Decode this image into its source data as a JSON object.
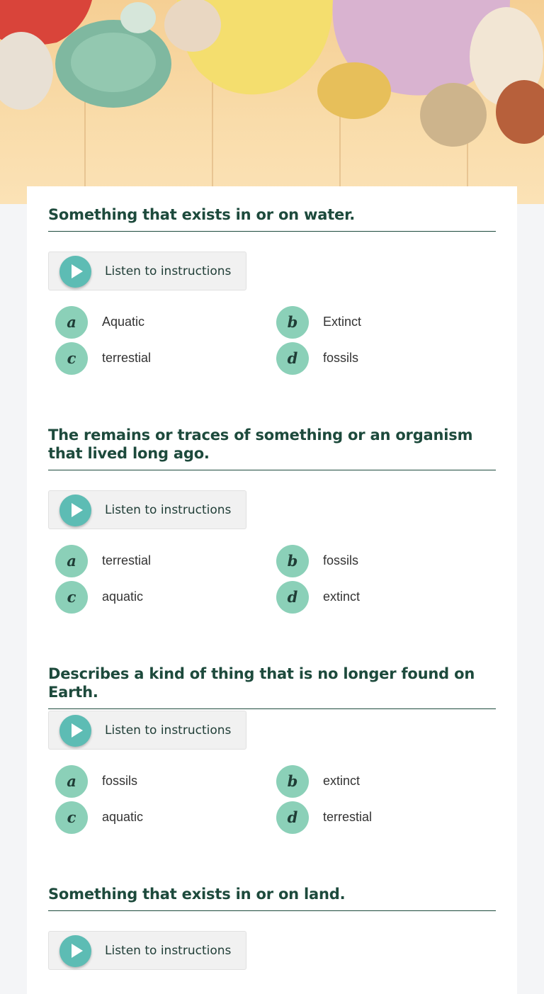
{
  "questions": [
    {
      "title": "Something that exists in or on water.",
      "listen_label": "Listen to instructions",
      "options": [
        {
          "letter": "a",
          "text": "Aquatic"
        },
        {
          "letter": "b",
          "text": "Extinct"
        },
        {
          "letter": "c",
          "text": "terrestial"
        },
        {
          "letter": "d",
          "text": "fossils"
        }
      ]
    },
    {
      "title": "The remains or traces of something or an organism that lived long ago.",
      "listen_label": "Listen to instructions",
      "options": [
        {
          "letter": "a",
          "text": "terrestial"
        },
        {
          "letter": "b",
          "text": "fossils"
        },
        {
          "letter": "c",
          "text": "aquatic"
        },
        {
          "letter": "d",
          "text": "extinct"
        }
      ]
    },
    {
      "title": "Describes a kind of thing that is no longer found on Earth.",
      "listen_label": "Listen to instructions",
      "options": [
        {
          "letter": "a",
          "text": "fossils"
        },
        {
          "letter": "b",
          "text": "extinct"
        },
        {
          "letter": "c",
          "text": "aquatic"
        },
        {
          "letter": "d",
          "text": "terrestial"
        }
      ]
    },
    {
      "title": "Something that exists in or on land.",
      "listen_label": "Listen to instructions",
      "options": []
    }
  ]
}
